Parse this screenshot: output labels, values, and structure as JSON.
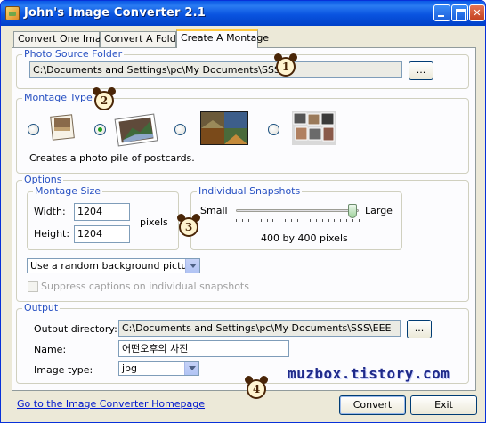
{
  "window": {
    "title": "John's Image Converter 2.1"
  },
  "tabs": [
    {
      "label": "Convert One Image"
    },
    {
      "label": "Convert A Folder"
    },
    {
      "label": "Create A Montage"
    }
  ],
  "photo_source": {
    "legend": "Photo Source Folder",
    "path": "C:\\Documents and Settings\\pc\\My Documents\\SSS",
    "browse_label": "..."
  },
  "montage_type": {
    "legend": "Montage Type",
    "options": [
      {
        "icon": "postcard-stack-thumbnail",
        "selected": false
      },
      {
        "icon": "photo-pile-thumbnail",
        "selected": true
      },
      {
        "icon": "grid-tiles-thumbnail",
        "selected": false
      },
      {
        "icon": "scattered-snapshots-thumbnail",
        "selected": false
      }
    ],
    "description": "Creates a photo pile of postcards."
  },
  "options": {
    "legend": "Options",
    "montage_size": {
      "legend": "Montage Size",
      "width_label": "Width:",
      "width_value": "1204",
      "height_label": "Height:",
      "height_value": "1204",
      "unit": "pixels"
    },
    "snapshots": {
      "legend": "Individual Snapshots",
      "small_label": "Small",
      "large_label": "Large",
      "level": 0.95,
      "readout": "400 by 400 pixels"
    },
    "background_select": "Use a random background picture",
    "suppress_captions_label": "Suppress captions on individual snapshots",
    "suppress_captions_checked": false
  },
  "output": {
    "legend": "Output",
    "dir_label": "Output directory:",
    "dir_value": "C:\\Documents and Settings\\pc\\My Documents\\SSS\\EEE",
    "browse_label": "...",
    "name_label": "Name:",
    "name_value": "어떤오후의 사진",
    "type_label": "Image type:",
    "type_value": "jpg"
  },
  "footer": {
    "homepage_link": "Go to the Image Converter Homepage",
    "convert_label": "Convert",
    "exit_label": "Exit"
  },
  "annotations": {
    "marker1": "1",
    "marker2": "2",
    "marker3": "3",
    "marker4": "4",
    "watermark": "muzbox.tistory.com"
  },
  "colors": {
    "titlebar": "#0a54e0",
    "legend_text": "#2750c2",
    "active_tab_accent": "#ffc83c",
    "marker_brown": "#4a2608"
  }
}
